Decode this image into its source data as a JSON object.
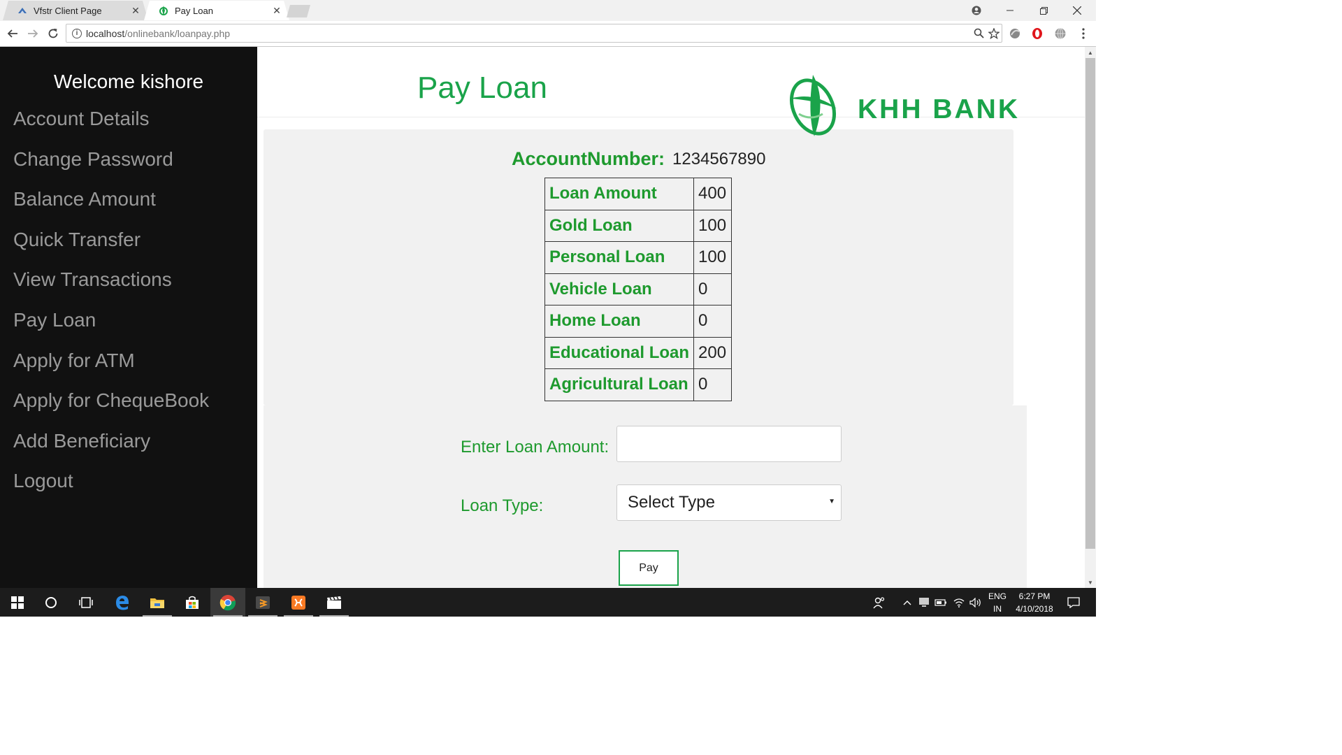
{
  "browser": {
    "tabs": [
      {
        "title": "Vfstr Client Page",
        "icon": "vfstr-favicon",
        "active": false
      },
      {
        "title": "Pay Loan",
        "icon": "khh-bank-favicon",
        "active": true
      }
    ],
    "url_host": "localhost",
    "url_path": "/onlinebank/loanpay.php"
  },
  "sidebar": {
    "welcome": "Welcome kishore",
    "items": [
      {
        "label": "Account Details"
      },
      {
        "label": "Change Password"
      },
      {
        "label": "Balance Amount"
      },
      {
        "label": "Quick Transfer"
      },
      {
        "label": "View Transactions"
      },
      {
        "label": "Pay Loan"
      },
      {
        "label": "Apply for ATM"
      },
      {
        "label": "Apply for ChequeBook"
      },
      {
        "label": "Add Beneficiary"
      },
      {
        "label": "Logout"
      }
    ]
  },
  "page": {
    "title": "Pay Loan",
    "logo_text": "KHH BANK",
    "account_label": "AccountNumber:",
    "account_number": "1234567890"
  },
  "loans": [
    {
      "label": "Loan Amount",
      "value": "400"
    },
    {
      "label": "Gold Loan",
      "value": "100"
    },
    {
      "label": "Personal Loan",
      "value": "100"
    },
    {
      "label": "Vehicle Loan",
      "value": "0"
    },
    {
      "label": "Home Loan",
      "value": "0"
    },
    {
      "label": "Educational Loan",
      "value": "200"
    },
    {
      "label": "Agricultural Loan",
      "value": "0"
    }
  ],
  "form": {
    "amount_label": "Enter Loan Amount:",
    "amount_value": "",
    "type_label": "Loan Type:",
    "type_selected": "Select Type",
    "pay_label": "Pay"
  },
  "taskbar": {
    "lang_top": "ENG",
    "lang_bottom": "IN",
    "time": "6:27 PM",
    "date": "4/10/2018"
  },
  "colors": {
    "accent_green": "#1aa34a",
    "label_green": "#1e9a2e",
    "sidebar_bg": "#111111",
    "panel_bg": "#f1f1f1"
  }
}
